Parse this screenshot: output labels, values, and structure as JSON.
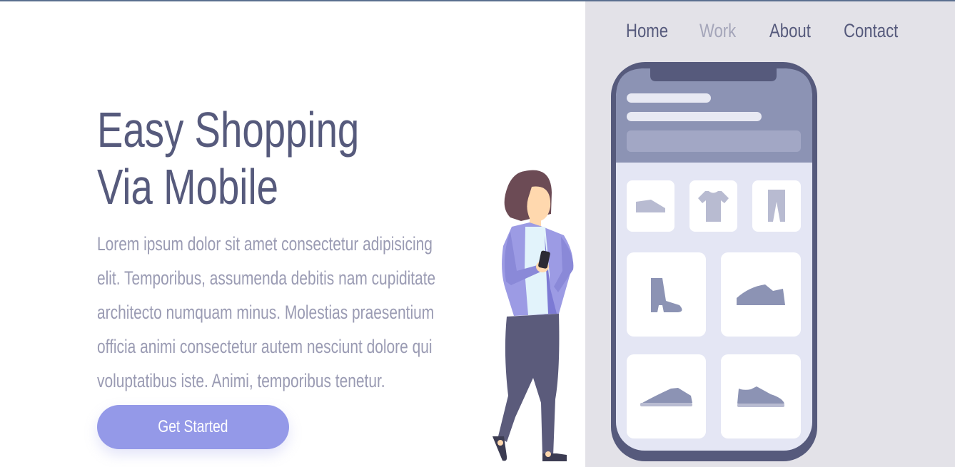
{
  "nav": {
    "items": [
      {
        "label": "Home",
        "active": false
      },
      {
        "label": "Work",
        "active": true
      },
      {
        "label": "About",
        "active": false
      },
      {
        "label": "Contact",
        "active": false
      }
    ]
  },
  "hero": {
    "title_line1": "Easy Shopping",
    "title_line2": "Via Mobile",
    "body_line1": "Lorem ipsum dolor sit amet consectetur adipisicing",
    "body_line2": "elit. Temporibus, assumenda debitis nam cupiditate",
    "body_line3": "architecto numquam minus. Molestias praesentium",
    "body_line4": "officia animi consectetur autem nesciunt dolore qui",
    "body_line5": "voluptatibus iste. Animi, temporibus tenetur.",
    "cta_label": "Get Started"
  },
  "colors": {
    "primary_text": "#565a7c",
    "muted_text": "#9a9bb3",
    "accent": "#9499e8",
    "panel_bg": "#e3e2e8",
    "phone_frame": "#565a7c"
  },
  "icons": [
    "shoe-icon",
    "tshirt-icon",
    "pants-icon",
    "boot-icon",
    "sneaker-icon",
    "sneaker-icon",
    "sneaker-icon"
  ]
}
